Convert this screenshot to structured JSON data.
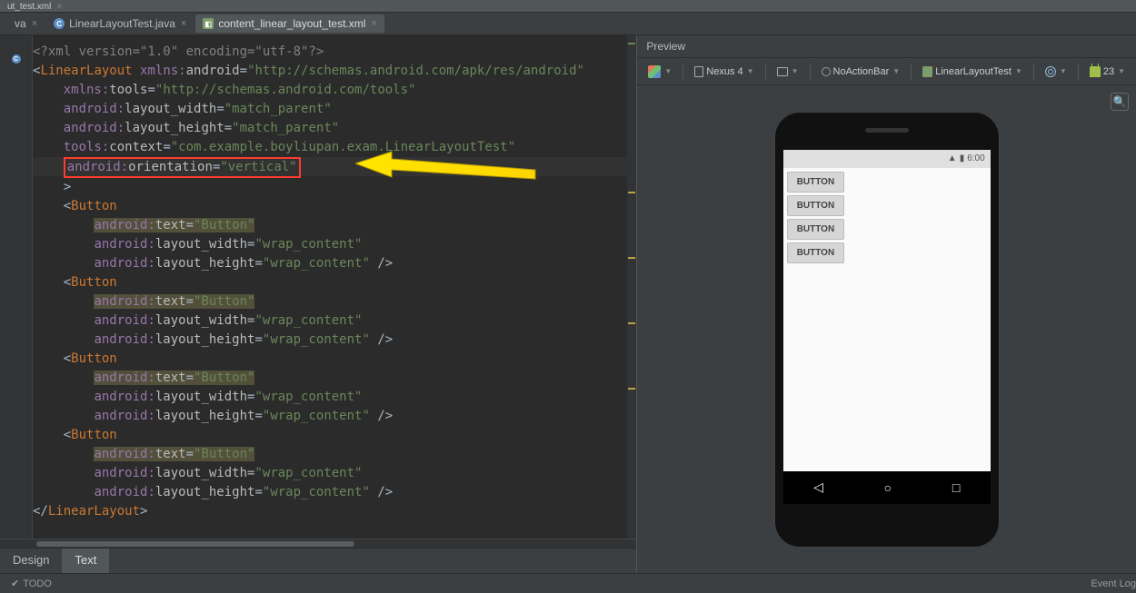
{
  "cropped_tab": "ut_test.xml",
  "tabs": {
    "partial": "va",
    "java": "LinearLayoutTest.java",
    "xml": "content_linear_layout_test.xml"
  },
  "code": {
    "l1_decl": "<?xml version=\"1.0\" encoding=\"utf-8\"?>",
    "l2_tag": "LinearLayout",
    "l2_ns": "xmlns:",
    "l2_attr": "android",
    "l2_val": "\"http://schemas.android.com/apk/res/android\"",
    "l3_ns": "xmlns:",
    "l3_attr": "tools",
    "l3_val": "\"http://schemas.android.com/tools\"",
    "l4_pre": "android:",
    "l4_attr": "layout_width",
    "l4_val": "\"match_parent\"",
    "l5_pre": "android:",
    "l5_attr": "layout_height",
    "l5_val": "\"match_parent\"",
    "l6_pre": "tools:",
    "l6_attr": "context",
    "l6_val": "\"com.example.boyliupan.exam.LinearLayoutTest\"",
    "l7_pre": "android:",
    "l7_attr": "orientation",
    "l7_val": "\"vertical\"",
    "btn_tag": "Button",
    "btn_text_pre": "android:",
    "btn_text_attr": "text",
    "btn_text_val": "\"Button\"",
    "btn_w_pre": "android:",
    "btn_w_attr": "layout_width",
    "btn_w_val": "\"wrap_content\"",
    "btn_h_pre": "android:",
    "btn_h_attr": "layout_height",
    "btn_h_val": "\"wrap_content\"",
    "close_tag": "LinearLayout"
  },
  "modes": {
    "design": "Design",
    "text": "Text"
  },
  "status": {
    "todo": "TODO",
    "event": "Event Log"
  },
  "preview": {
    "title": "Preview",
    "device": "Nexus 4",
    "theme": "NoActionBar",
    "layout": "LinearLayoutTest",
    "api": "23",
    "time": "6:00",
    "button_label": "BUTTON"
  }
}
